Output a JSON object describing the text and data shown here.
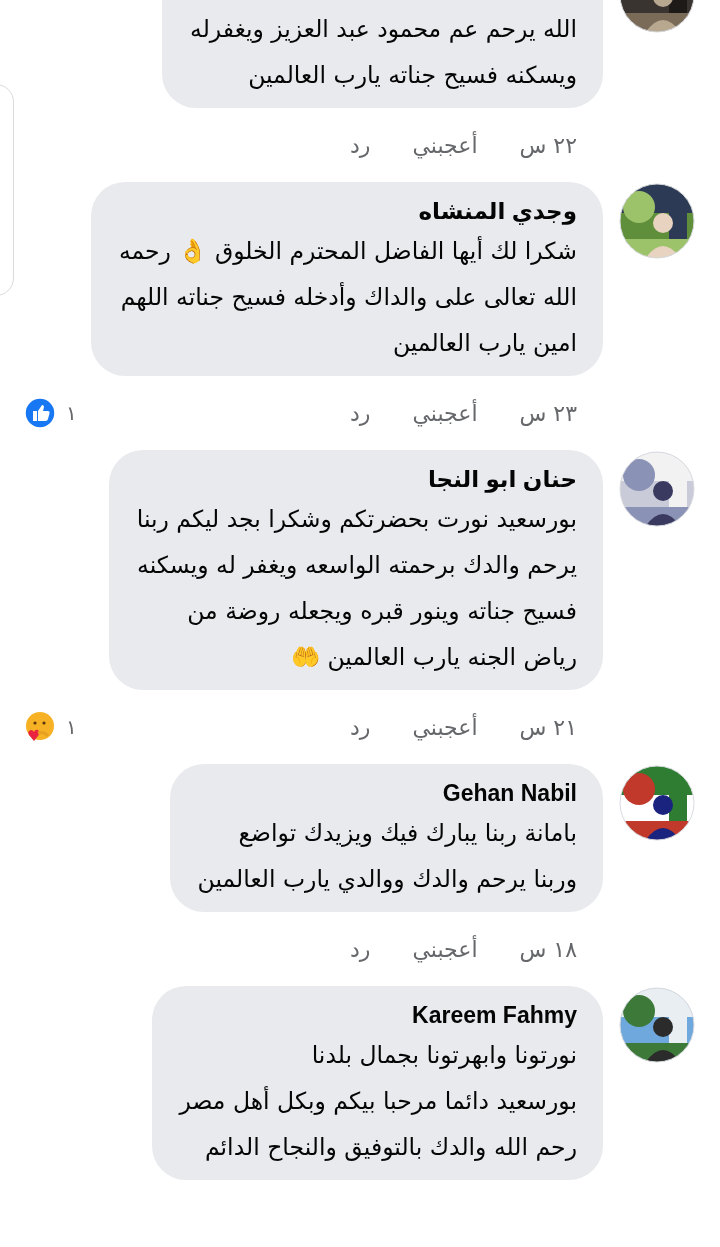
{
  "comments": [
    {
      "text": "الله يرحم عم محمود عبد العزيز ويغفرله\nويسكنه فسيح جناته يارب العالمين",
      "time": "٢٢ س",
      "like": "أعجبني",
      "reply": "رد"
    },
    {
      "author": "وجدي المنشاه",
      "text": "شكرا لك أيها الفاضل المحترم الخلوق 👌 رحمه\nالله تعالى على والداك وأدخله فسيح جناته اللهم\nامين يارب العالمين",
      "time": "٢٣ س",
      "like": "أعجبني",
      "reply": "رد",
      "reaction": {
        "kind": "like",
        "count": "١"
      }
    },
    {
      "author": "حنان ابو النجا",
      "text": "بورسعيد نورت بحضرتكم وشكرا بجد ليكم ربنا\nيرحم والدك برحمته الواسعه ويغفر له ويسكنه\nفسيح جناته وينور قبره ويجعله روضة من\nرياض الجنه يارب العالمين 🤲",
      "time": "٢١ س",
      "like": "أعجبني",
      "reply": "رد",
      "reaction": {
        "kind": "care",
        "count": "١"
      }
    },
    {
      "author": "Gehan Nabil",
      "text": "بامانة ربنا يبارك فيك ويزيدك تواضع\nوربنا يرحم والدك ووالدي يارب العالمين",
      "time": "١٨ س",
      "like": "أعجبني",
      "reply": "رد"
    },
    {
      "author": "Kareem Fahmy",
      "text": "نورتونا وابهرتونا بجمال بلدنا\nبورسعيد دائما مرحبا بيكم وبكل أهل مصر\nرحم الله والدك بالتوفيق والنجاح الدائم"
    }
  ]
}
